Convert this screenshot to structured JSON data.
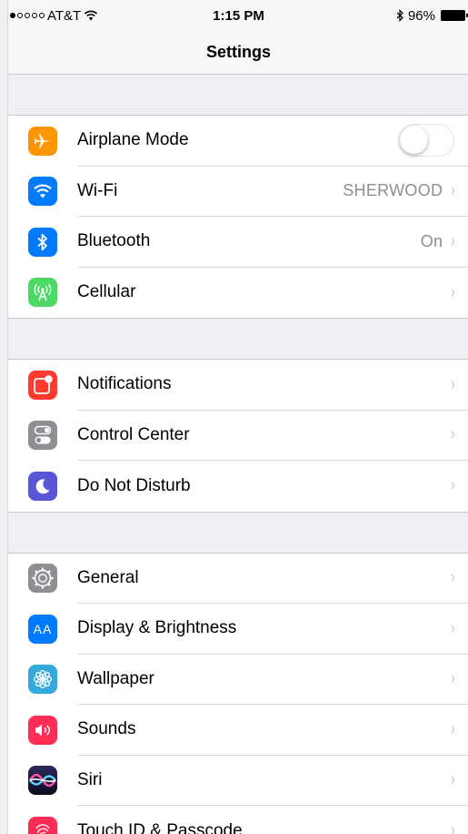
{
  "status": {
    "carrier": "AT&T",
    "time": "1:15 PM",
    "battery": "96%",
    "signal_dots_filled": 1,
    "signal_dots_total": 5
  },
  "nav": {
    "title": "Settings"
  },
  "groups": [
    {
      "rows": [
        {
          "label": "Airplane Mode",
          "icon": "airplane-icon",
          "color": "#ff9500",
          "control": "toggle",
          "toggle_on": false
        },
        {
          "label": "Wi-Fi",
          "icon": "wifi-icon",
          "color": "#007aff",
          "value": "SHERWOOD"
        },
        {
          "label": "Bluetooth",
          "icon": "bluetooth-icon",
          "color": "#007aff",
          "value": "On"
        },
        {
          "label": "Cellular",
          "icon": "cellular-icon",
          "color": "#4cd964"
        }
      ]
    },
    {
      "rows": [
        {
          "label": "Notifications",
          "icon": "notifications-icon",
          "color": "#ff3b30"
        },
        {
          "label": "Control Center",
          "icon": "control-center-icon",
          "color": "#8e8e93"
        },
        {
          "label": "Do Not Disturb",
          "icon": "moon-icon",
          "color": "#5856d6"
        }
      ]
    },
    {
      "rows": [
        {
          "label": "General",
          "icon": "gear-icon",
          "color": "#8e8e93"
        },
        {
          "label": "Display & Brightness",
          "icon": "display-icon",
          "color": "#007aff",
          "glyph": "AA"
        },
        {
          "label": "Wallpaper",
          "icon": "wallpaper-icon",
          "color": "#34aadc"
        },
        {
          "label": "Sounds",
          "icon": "speaker-icon",
          "color": "#ff2d55"
        },
        {
          "label": "Siri",
          "icon": "siri-icon",
          "color": "#1c1c3a"
        },
        {
          "label": "Touch ID & Passcode",
          "icon": "fingerprint-icon",
          "color": "#ff2d55"
        }
      ]
    }
  ],
  "chevron": "›"
}
